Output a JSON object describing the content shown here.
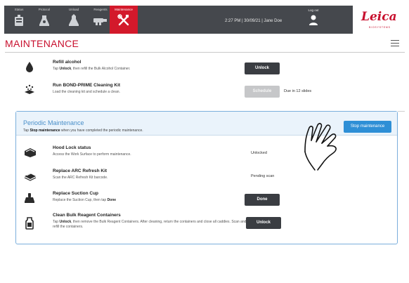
{
  "nav": {
    "tabs": [
      {
        "label": "Status",
        "icon": "slide-tray-icon",
        "active": false
      },
      {
        "label": "Protocol",
        "icon": "protocol-flask-icon",
        "active": false
      },
      {
        "label": "Unload",
        "icon": "unload-flask-icon",
        "active": false
      },
      {
        "label": "Reagents",
        "icon": "reagents-icon",
        "active": false
      },
      {
        "label": "Maintenance",
        "icon": "tools-icon",
        "active": true
      }
    ],
    "time": "2:27 PM",
    "date": "30/09/21",
    "user": "Jane Doe",
    "status_line": "2:27 PM  |  30/09/21  |  Jane Doe",
    "logout_label": "Log out"
  },
  "brand": {
    "name": "Leica",
    "sub": "BIOSYSTEMS",
    "color": "#c8102e"
  },
  "page": {
    "title": "MAINTENANCE"
  },
  "tasks": [
    {
      "title": "Refill alcohol",
      "desc_pre": "Tap ",
      "desc_bold": "Unlock",
      "desc_post": ", then refill the Bulk Alcohol Container.",
      "button": "Unlock",
      "icon": "alcohol-drop-icon"
    },
    {
      "title": "Run BOND-PRIME Cleaning Kit",
      "desc": "Load the cleaning kit and schedule a clean.",
      "button": "Schedule",
      "button_disabled": true,
      "due": "Due in 12 slides",
      "icon": "cleaning-kit-icon"
    }
  ],
  "periodic": {
    "title": "Periodic Maintenance",
    "sub_pre": "Tap ",
    "sub_bold": "Stop maintenance",
    "sub_post": " when you have completed the periodic maintenance.",
    "stop_button": "Stop maintenance",
    "items": [
      {
        "title": "Hood Lock status",
        "desc": "Access the Work Surface to perform maintenance.",
        "status": "Unlocked",
        "icon": "hood-lock-icon"
      },
      {
        "title": "Replace ARC Refresh Kit",
        "desc": "Scan the ARC Refresh Kit barcode.",
        "status": "Pending scan",
        "icon": "arc-kit-icon"
      },
      {
        "title": "Replace Suction Cup",
        "desc_pre": "Replace the Suction Cup, then tap ",
        "desc_bold": "Done",
        "button": "Done",
        "icon": "suction-cup-icon"
      },
      {
        "title": "Clean Bulk Reagent Containers",
        "desc_pre": "Tap ",
        "desc_bold": "Unlock",
        "desc_post": ", then remove the Bulk Reagent Containers. After cleaning, return the containers and close all caddies. Scan and refill the containers.",
        "button": "Unlock",
        "icon": "reagent-container-icon"
      }
    ]
  },
  "colors": {
    "accent": "#c8102e",
    "panel_border": "#7aaedc",
    "primary_button": "#3a3d42",
    "blue_button": "#2e8fd6",
    "topbar": "#45484d"
  }
}
